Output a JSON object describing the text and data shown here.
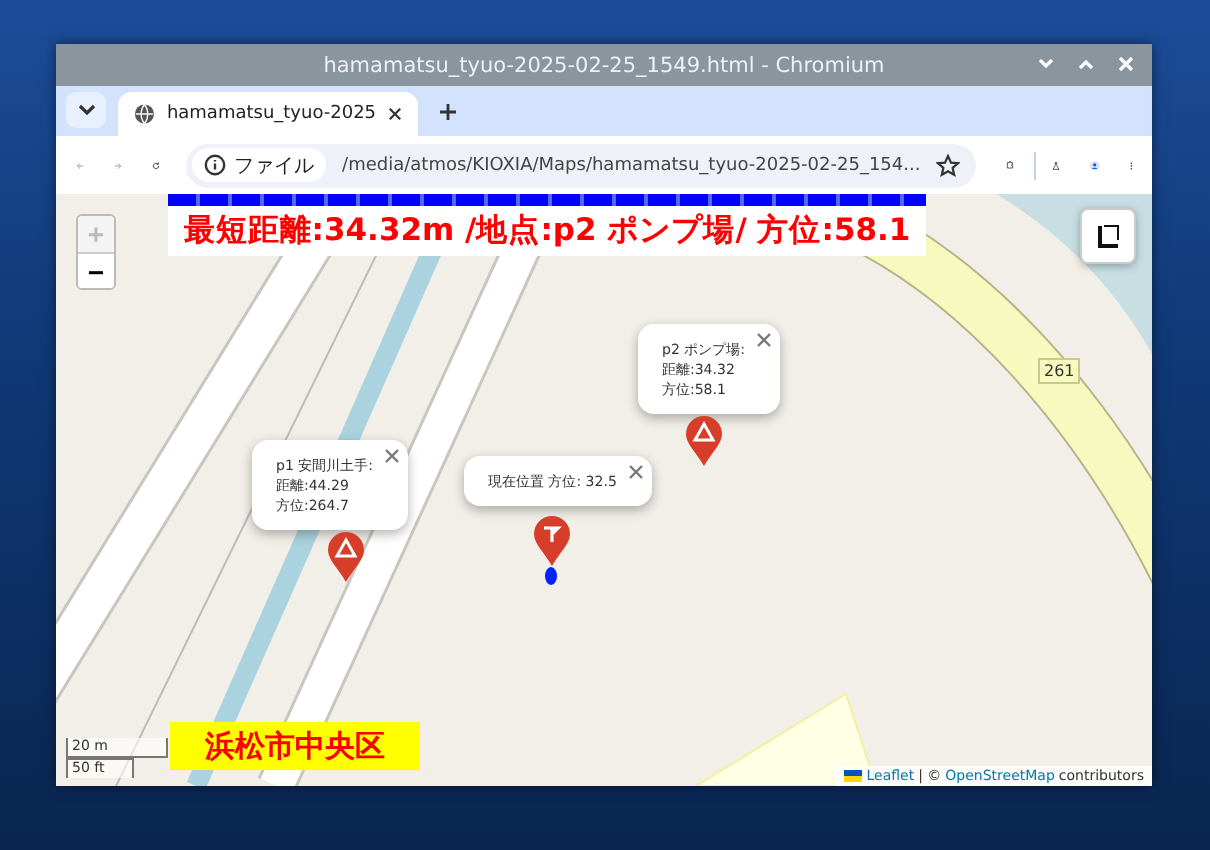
{
  "window": {
    "title": "hamamatsu_tyuo-2025-02-25_1549.html - Chromium"
  },
  "tabs": [
    {
      "label": "hamamatsu_tyuo-2025",
      "selected": true
    }
  ],
  "address_bar": {
    "scheme": "ファイル",
    "url": "/media/atmos/KIOXIA/Maps/hamamatsu_tyuo-2025-02-25_154..."
  },
  "map": {
    "banner": "最短距離:34.32m /地点:p2 ポンプ場/ 方位:58.1",
    "zoom_in": {
      "label": "+",
      "disabled": true
    },
    "zoom_out": {
      "label": "−",
      "disabled": false
    },
    "road_label": "261",
    "popups": [
      {
        "kind": "hazard",
        "lines": [
          "p1 安間川土手:",
          "距離:44.29",
          "方位:264.7"
        ]
      },
      {
        "kind": "current",
        "lines": [
          "現在位置 方位: 32.5"
        ]
      },
      {
        "kind": "hazard",
        "lines": [
          "p2 ポンプ場:",
          "距離:34.32",
          "方位:58.1"
        ]
      }
    ],
    "district": "浜松市中央区",
    "scale": [
      "20 m",
      "50 ft"
    ],
    "attribution": {
      "leaflet": "Leaflet",
      "separator": "| ©",
      "osm": "OpenStreetMap",
      "suffix": "contributors"
    }
  }
}
